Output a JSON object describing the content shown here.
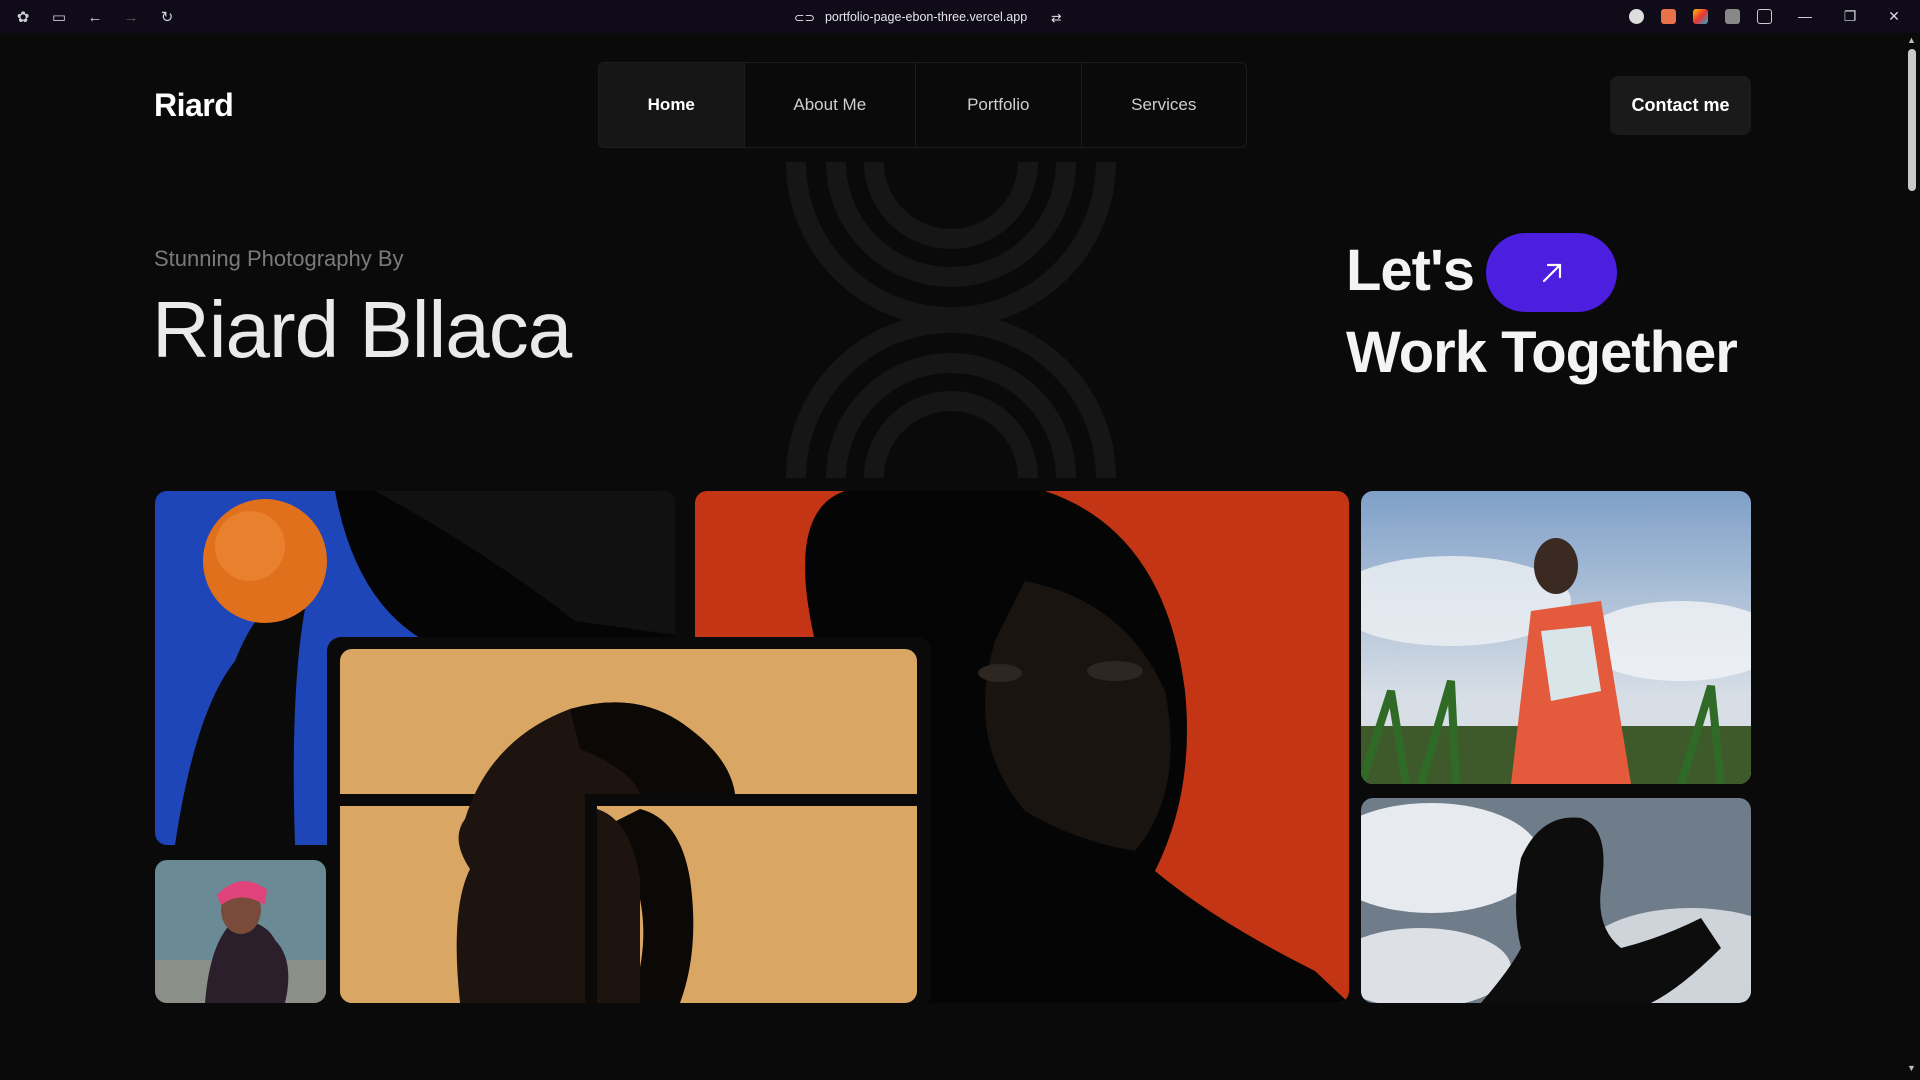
{
  "browser": {
    "url": "portfolio-page-ebon-three.vercel.app",
    "window_controls": [
      "minimize",
      "restore",
      "close"
    ]
  },
  "header": {
    "logo": "Riard",
    "nav": [
      {
        "label": "Home",
        "active": true
      },
      {
        "label": "About Me",
        "active": false
      },
      {
        "label": "Portfolio",
        "active": false
      },
      {
        "label": "Services",
        "active": false
      }
    ],
    "contact_label": "Contact me"
  },
  "hero": {
    "subtitle": "Stunning Photography By",
    "name": "Riard Bllaca",
    "cta_line1": "Let's",
    "cta_line2": "Work Together",
    "cta_icon": "arrow-up-right-icon"
  },
  "colors": {
    "background": "#0a0a0a",
    "accent": "#4b1ee0",
    "muted_text": "#7a7a7a"
  }
}
